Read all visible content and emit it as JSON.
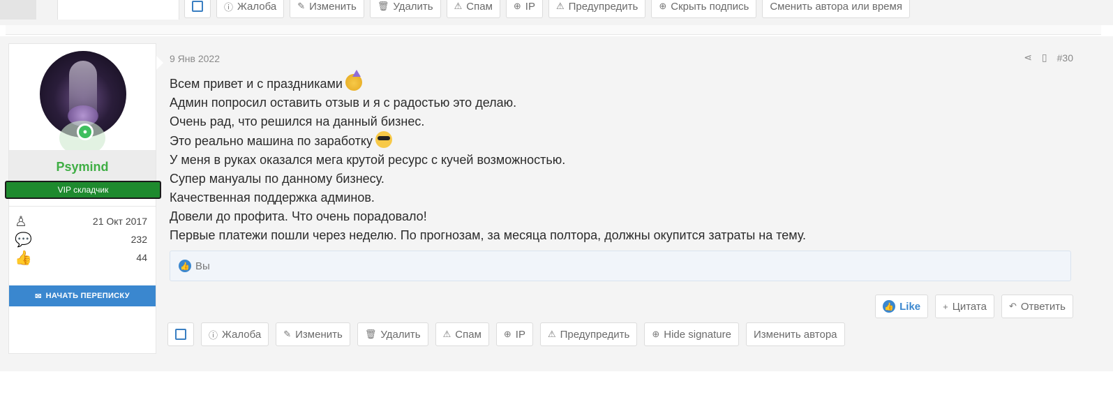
{
  "prev_toolbar": {
    "complaint": "Жалоба",
    "edit": "Изменить",
    "delete": "Удалить",
    "spam": "Спам",
    "ip": "IP",
    "warn": "Предупредить",
    "hide_signature": "Скрыть подпись",
    "change_author": "Сменить автора или время"
  },
  "user": {
    "name": "Psymind",
    "badge": "VIP складчик",
    "joined": "21 Окт 2017",
    "messages": "232",
    "likes": "44",
    "start_conversation": "НАЧАТЬ ПЕРЕПИСКУ"
  },
  "post": {
    "date": "9 Янв 2022",
    "number": "#30",
    "lines": [
      "Всем привет и с праздниками",
      "Админ попросил оставить отзыв и я с радостью это делаю.",
      "Очень рад, что решился на данный бизнес.",
      "Это реально машина по заработку",
      "У меня в руках оказался мега крутой ресурс с кучей возможностью.",
      "Супер мануалы по данному бизнесу.",
      "Качественная поддержка админов.",
      "Довели до профита. Что очень порадовало!",
      "Первые платежи пошли через неделю. По прогнозам, за месяца полтора, должны окупится затраты на тему."
    ],
    "reactions_text": "Вы"
  },
  "actions": {
    "like": "Like",
    "quote": "Цитата",
    "reply": "Ответить"
  },
  "mod_toolbar": {
    "complaint": "Жалоба",
    "edit": "Изменить",
    "delete": "Удалить",
    "spam": "Спам",
    "ip": "IP",
    "warn": "Предупредить",
    "hide_signature": "Hide signature",
    "change_author": "Изменить автора"
  },
  "colors": {
    "accent": "#3a87cf",
    "username": "#3fae44",
    "vip_badge": "#1e8a2e"
  }
}
